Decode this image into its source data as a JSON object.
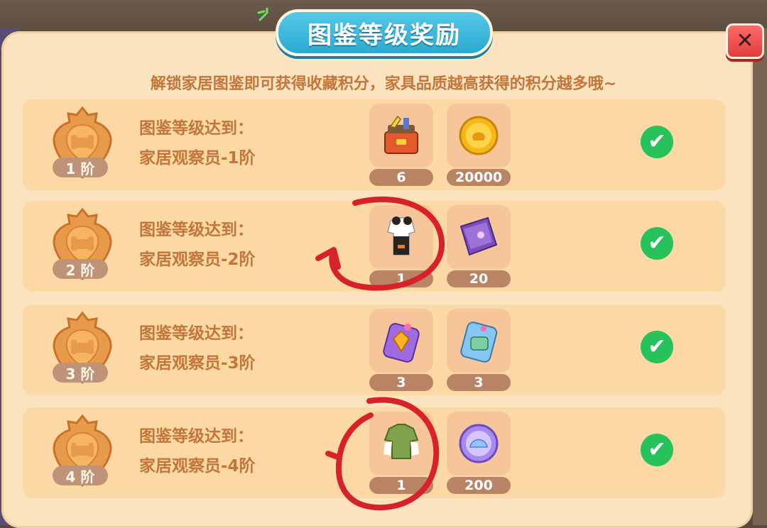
{
  "title": "图鉴等级奖励",
  "close_label": "✕",
  "description": "解锁家居图鉴即可获得收藏积分，家具品质越高获得的积分越多哦~",
  "rows": [
    {
      "tier_label": "1 阶",
      "requirement_line1": "图鉴等级达到：",
      "requirement_line2": "家居观察员-1阶",
      "rewards": [
        {
          "icon": "toolbox-icon",
          "count": "6"
        },
        {
          "icon": "gold-coin-icon",
          "count": "20000"
        }
      ],
      "claimed": true
    },
    {
      "tier_label": "2 阶",
      "requirement_line1": "图鉴等级达到：",
      "requirement_line2": "家居观察员-2阶",
      "rewards": [
        {
          "icon": "outfit-black-white-icon",
          "count": "1"
        },
        {
          "icon": "purple-book-icon",
          "count": "20"
        }
      ],
      "claimed": true
    },
    {
      "tier_label": "3 阶",
      "requirement_line1": "图鉴等级达到：",
      "requirement_line2": "家居观察员-3阶",
      "rewards": [
        {
          "icon": "orange-gem-card-icon",
          "count": "3"
        },
        {
          "icon": "blue-furniture-card-icon",
          "count": "3"
        }
      ],
      "claimed": true
    },
    {
      "tier_label": "4 阶",
      "requirement_line1": "图鉴等级达到：",
      "requirement_line2": "家居观察员-4阶",
      "rewards": [
        {
          "icon": "green-shirt-icon",
          "count": "1"
        },
        {
          "icon": "purple-shell-coin-icon",
          "count": "200"
        }
      ],
      "claimed": true
    }
  ],
  "colors": {
    "panel": "#fbe3bf",
    "row": "#fcd9a4",
    "title_pill": "#2ba9cf",
    "text": "#c2763b",
    "check": "#27c25c",
    "close": "#e13d3d",
    "annotation": "#d8222a"
  }
}
